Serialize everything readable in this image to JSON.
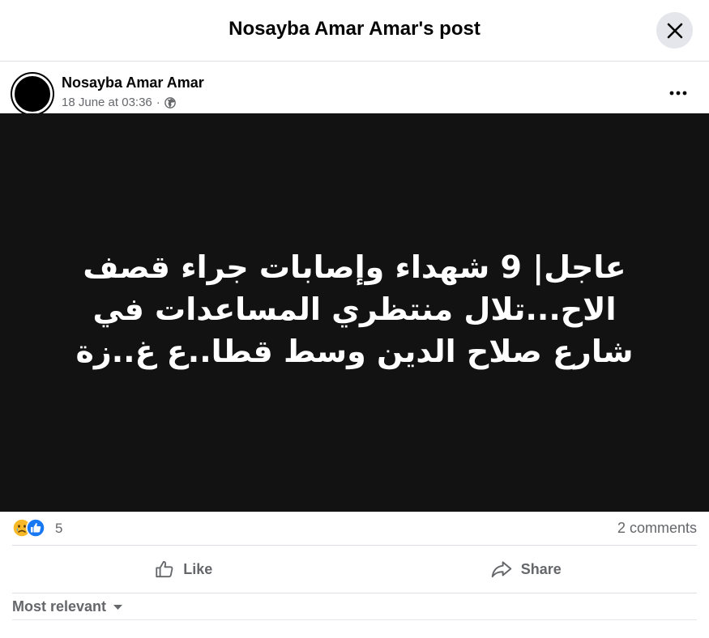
{
  "dialog": {
    "title": "Nosayba Amar Amar's post",
    "close_icon": "close-icon"
  },
  "post": {
    "author": "Nosayba Amar Amar",
    "timestamp": "18 June at 03:36",
    "separator": "·",
    "audience_icon": "globe-icon",
    "more_icon": "more-icon",
    "image_text": "عاجل| 9 شهداء وإصابات جراء قصف الاح...تلال منتظري المساعدات في شارع صلاح الدين وسط قطا..ع غ..زة",
    "image_background": "#121212"
  },
  "stats": {
    "reactions": [
      "sad-reaction-icon",
      "like-reaction-icon"
    ],
    "reaction_count": "5",
    "comments": "2 comments"
  },
  "actions": {
    "like_label": "Like",
    "share_label": "Share"
  },
  "comments": {
    "sort_label": "Most relevant"
  },
  "colors": {
    "text_primary": "#050505",
    "text_secondary": "#65676b",
    "like_blue": "#1877f2",
    "divider": "#dcdfe3"
  }
}
